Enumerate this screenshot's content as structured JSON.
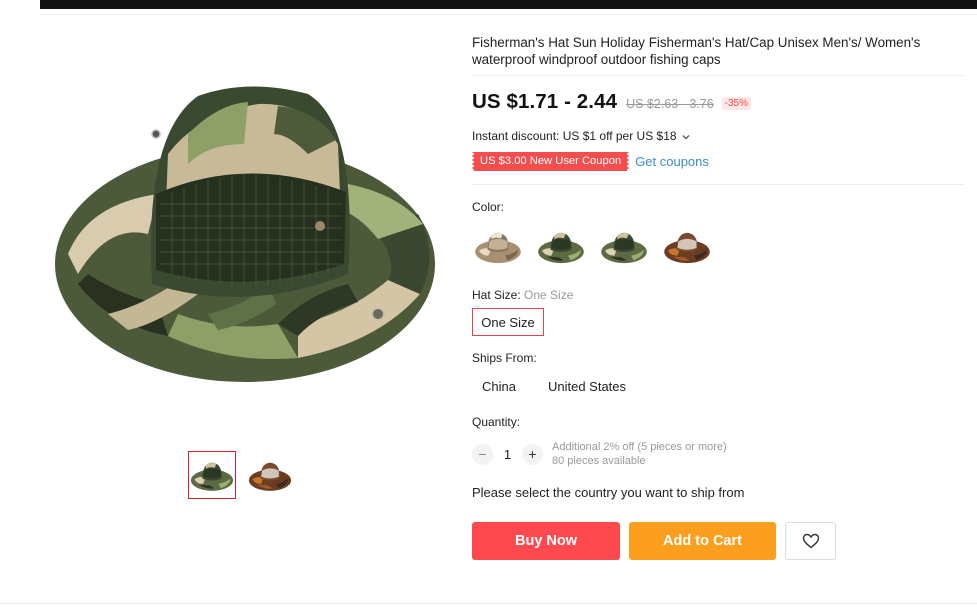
{
  "product": {
    "title": "Fisherman's Hat Sun Holiday Fisherman's Hat/Cap Unisex Men's/ Women's waterproof windproof outdoor fishing caps"
  },
  "price": {
    "current": "US $1.71 - 2.44",
    "original": "US $2.63 - 3.76",
    "discount": "-35%"
  },
  "promo": {
    "instant_discount": "Instant discount: US $1 off per US $18",
    "coupon": "US $3.00 New User Coupon",
    "get_coupons": "Get coupons"
  },
  "color": {
    "label": "Color:",
    "options": [
      "tan-camo",
      "green-camo-1",
      "green-camo-2",
      "brown-camo"
    ]
  },
  "size": {
    "label": "Hat Size:",
    "selected_value": "One Size",
    "option": "One Size"
  },
  "ships_from": {
    "label": "Ships From:",
    "options": [
      "China",
      "United States"
    ]
  },
  "quantity": {
    "label": "Quantity:",
    "value": "1",
    "minus": "−",
    "plus": "+",
    "additional": "Additional 2% off (5 pieces or more)",
    "available": "80 pieces available"
  },
  "ship_note": "Please select the country you want to ship from",
  "actions": {
    "buy_now": "Buy Now",
    "add_to_cart": "Add to Cart"
  },
  "icons": {
    "wishlist": "heart-icon",
    "dropdown": "chevron-down-icon"
  },
  "colors": {
    "buy_now": "#fe4a4f",
    "add_to_cart": "#fd9f1e",
    "coupon": "#f44d4d",
    "link": "#3a8ec9",
    "selected_border": "#e0474c"
  }
}
